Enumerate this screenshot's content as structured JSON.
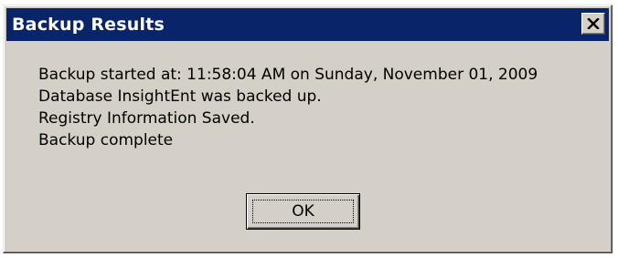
{
  "window": {
    "title": "Backup Results",
    "close_icon": "close-icon"
  },
  "messages": [
    "Backup started at: 11:58:04 AM on Sunday, November 01, 2009",
    "Database InsightEnt was backed up.",
    "Registry Information Saved.",
    "Backup complete"
  ],
  "buttons": {
    "ok_label": "OK"
  },
  "colors": {
    "titlebar": "#0a246a",
    "dialog_bg": "#d4d0c8",
    "title_text": "#ffffff"
  }
}
